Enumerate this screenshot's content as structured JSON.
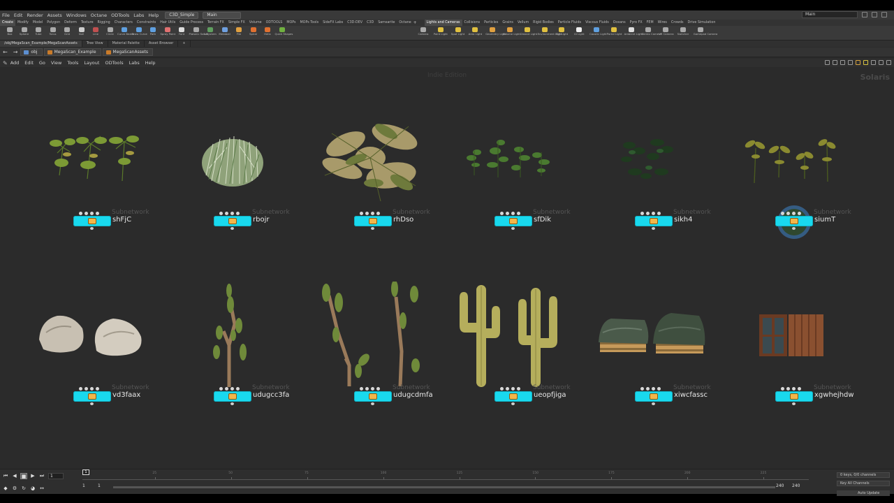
{
  "menubar": {
    "items": [
      "File",
      "Edit",
      "Render",
      "Assets",
      "Windows",
      "Octane",
      "ODTools",
      "Labs",
      "Help"
    ],
    "desktop_tab": "C3D_Simple",
    "main_tab": "Main",
    "desktop_select": "Main"
  },
  "shelf_tabs_left": [
    "Create",
    "Modify",
    "Model",
    "Polygon",
    "Deform",
    "Texture",
    "Rigging",
    "Characters",
    "Constraints",
    "Hair Utils",
    "Guide Process",
    "Terrain FX",
    "Simple FX",
    "Volume",
    "ODTOOLS",
    "MOPs",
    "MOPs Tools",
    "SideFX Labs",
    "C3D-DEV",
    "C3D",
    "Samsarite",
    "Octane"
  ],
  "shelf_tabs_right": [
    "Lights and Cameras",
    "Collisions",
    "Particles",
    "Grains",
    "Vellum",
    "Rigid Bodies",
    "Particle Fluids",
    "Viscous Fluids",
    "Oceans",
    "Pyro FX",
    "FEM",
    "Wires",
    "Crowds",
    "Drive Simulation"
  ],
  "tools_left": [
    {
      "label": "Box",
      "color": "#aaaaaa"
    },
    {
      "label": "Sphere",
      "color": "#aaaaaa"
    },
    {
      "label": "Tube",
      "color": "#aaaaaa"
    },
    {
      "label": "Torus",
      "color": "#aaaaaa"
    },
    {
      "label": "Grid",
      "color": "#aaaaaa"
    },
    {
      "label": "Null",
      "color": "#cccccc"
    },
    {
      "label": "Line",
      "color": "#c05050"
    },
    {
      "label": "Circle",
      "color": "#aaaaaa"
    },
    {
      "label": "Curve Bezier",
      "color": "#5fa0e0"
    },
    {
      "label": "Draw Curve",
      "color": "#5fa0e0"
    },
    {
      "label": "Path",
      "color": "#5fa0e0"
    },
    {
      "label": "Spray Paint",
      "color": "#e07070"
    },
    {
      "label": "Font",
      "color": "#dddddd"
    },
    {
      "label": "Platonic Solids",
      "color": "#aaaaaa"
    },
    {
      "label": "L-System",
      "color": "#5f9f5f"
    },
    {
      "label": "Metaball",
      "color": "#6fa0e0"
    },
    {
      "label": "File",
      "color": "#e0a040"
    },
    {
      "label": "Spiral",
      "color": "#e07030"
    },
    {
      "label": "Helix",
      "color": "#e07030"
    },
    {
      "label": "Quick Shapes",
      "color": "#70b040"
    }
  ],
  "tools_right": [
    {
      "label": "Camera",
      "color": "#aaaaaa"
    },
    {
      "label": "Point Light",
      "color": "#e0c040"
    },
    {
      "label": "Spot Light",
      "color": "#e0c040"
    },
    {
      "label": "Area Light",
      "color": "#e0c040"
    },
    {
      "label": "Geometry Light",
      "color": "#e0a040"
    },
    {
      "label": "Volume Light",
      "color": "#e0a040"
    },
    {
      "label": "Distant Light",
      "color": "#e0c040"
    },
    {
      "label": "Environment Light",
      "color": "#e0c040"
    },
    {
      "label": "Sky Light",
      "color": "#e0c040"
    },
    {
      "label": "GI Light",
      "color": "#eeeeee"
    },
    {
      "label": "Caustic Light",
      "color": "#5fa0e0"
    },
    {
      "label": "Portal Light",
      "color": "#e0c040"
    },
    {
      "label": "Ambient Light",
      "color": "#dddddd"
    },
    {
      "label": "Stereo Camera",
      "color": "#aaaaaa"
    },
    {
      "label": "VR Camera",
      "color": "#aaaaaa"
    },
    {
      "label": "Switcher",
      "color": "#aaaaaa"
    },
    {
      "label": "Gamepad Camera",
      "color": "#aaaaaa"
    }
  ],
  "pane_tabs": [
    "/obj/MegaScan_Example/MegaScanAssets",
    "Tree View",
    "Material Palette",
    "Asset Browser"
  ],
  "path": {
    "root": "obj",
    "crumbs": [
      "MegaScan_Example",
      "MegaScanAssets"
    ]
  },
  "net_menu": [
    "Add",
    "Edit",
    "Go",
    "View",
    "Tools",
    "Layout",
    "ODTools",
    "Labs",
    "Help"
  ],
  "network": {
    "watermark": "Indie Edition",
    "context": "Solaris",
    "node_type": "Subnetwork",
    "nodes_row1": [
      {
        "name": "shFjC",
        "preview": "fern-plant-1",
        "selected": false
      },
      {
        "name": "rbojr",
        "preview": "grass-bush",
        "selected": false
      },
      {
        "name": "rhDso",
        "preview": "fern-large",
        "selected": false
      },
      {
        "name": "sfDik",
        "preview": "small-plants",
        "selected": false
      },
      {
        "name": "sikh4",
        "preview": "dark-plants",
        "selected": false
      },
      {
        "name": "siumT",
        "preview": "palm-plants",
        "selected": true
      }
    ],
    "nodes_row2": [
      {
        "name": "vd3faax",
        "preview": "rocks",
        "selected": false
      },
      {
        "name": "udugcc3fa",
        "preview": "prickly-pear-1",
        "selected": false
      },
      {
        "name": "udugcdmfa",
        "preview": "prickly-pear-2",
        "selected": false
      },
      {
        "name": "ueopfjiga",
        "preview": "saguaro-cacti",
        "selected": false
      },
      {
        "name": "xiwcfassc",
        "preview": "covered-pallets",
        "selected": false
      },
      {
        "name": "xgwhejhdw",
        "preview": "wooden-window",
        "selected": false
      }
    ]
  },
  "timeline": {
    "current_frame": "1",
    "start": "1",
    "start2": "1",
    "end": "240",
    "end2": "240",
    "ticks": [
      "25",
      "50",
      "75",
      "100",
      "125",
      "150",
      "175",
      "200",
      "225"
    ],
    "keys_info": "0 keys, 0/0 channels",
    "key_all": "Key All Channels",
    "auto_update": "Auto Update"
  }
}
